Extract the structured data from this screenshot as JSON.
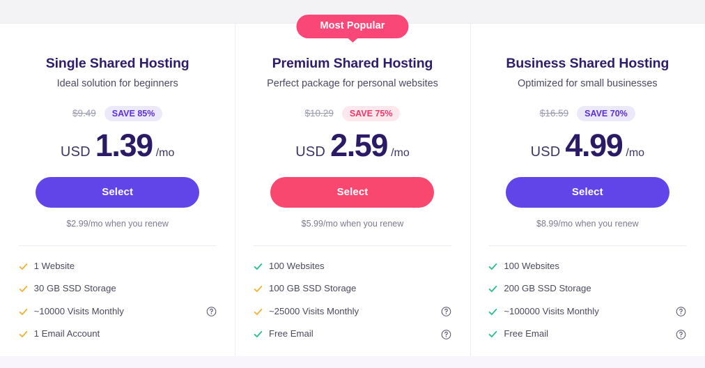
{
  "colors": {
    "brand_purple": "#6245e8",
    "brand_pink": "#f9486f",
    "heading": "#2f1c6a",
    "check_green": "#2ec08a",
    "check_gold": "#f0b537",
    "page_bg": "#f3f3f5",
    "bottom_strip": "#f8f5fc"
  },
  "plans": [
    {
      "id": "single-shared-hosting",
      "title": "Single Shared Hosting",
      "subtitle": "Ideal solution for beginners",
      "old_price": "$9.49",
      "save_badge": "SAVE 85%",
      "save_style": "purple",
      "currency": "USD",
      "price": "1.39",
      "per": "/mo",
      "cta_label": "Select",
      "cta_style": "purple",
      "renew_note": "$2.99/mo when you renew",
      "popular": false,
      "popular_label": "",
      "features": [
        {
          "label": "1 Website",
          "check": "gold",
          "help": false
        },
        {
          "label": "30 GB SSD Storage",
          "check": "gold",
          "help": false
        },
        {
          "label": "~10000 Visits Monthly",
          "check": "gold",
          "help": true
        },
        {
          "label": "1 Email Account",
          "check": "gold",
          "help": false
        }
      ]
    },
    {
      "id": "premium-shared-hosting",
      "title": "Premium Shared Hosting",
      "subtitle": "Perfect package for personal websites",
      "old_price": "$10.29",
      "save_badge": "SAVE 75%",
      "save_style": "pink",
      "currency": "USD",
      "price": "2.59",
      "per": "/mo",
      "cta_label": "Select",
      "cta_style": "pink",
      "renew_note": "$5.99/mo when you renew",
      "popular": true,
      "popular_label": "Most Popular",
      "features": [
        {
          "label": "100 Websites",
          "check": "green",
          "help": false
        },
        {
          "label": "100 GB SSD Storage",
          "check": "gold",
          "help": false
        },
        {
          "label": "~25000 Visits Monthly",
          "check": "gold",
          "help": true
        },
        {
          "label": "Free Email",
          "check": "green",
          "help": true
        }
      ]
    },
    {
      "id": "business-shared-hosting",
      "title": "Business Shared Hosting",
      "subtitle": "Optimized for small businesses",
      "old_price": "$16.59",
      "save_badge": "SAVE 70%",
      "save_style": "purple",
      "currency": "USD",
      "price": "4.99",
      "per": "/mo",
      "cta_label": "Select",
      "cta_style": "purple",
      "renew_note": "$8.99/mo when you renew",
      "popular": false,
      "popular_label": "",
      "features": [
        {
          "label": "100 Websites",
          "check": "green",
          "help": false
        },
        {
          "label": "200 GB SSD Storage",
          "check": "green",
          "help": false
        },
        {
          "label": "~100000 Visits Monthly",
          "check": "green",
          "help": true
        },
        {
          "label": "Free Email",
          "check": "green",
          "help": true
        }
      ]
    }
  ],
  "icons": {
    "check": "check-icon",
    "help": "help-circle-icon"
  }
}
